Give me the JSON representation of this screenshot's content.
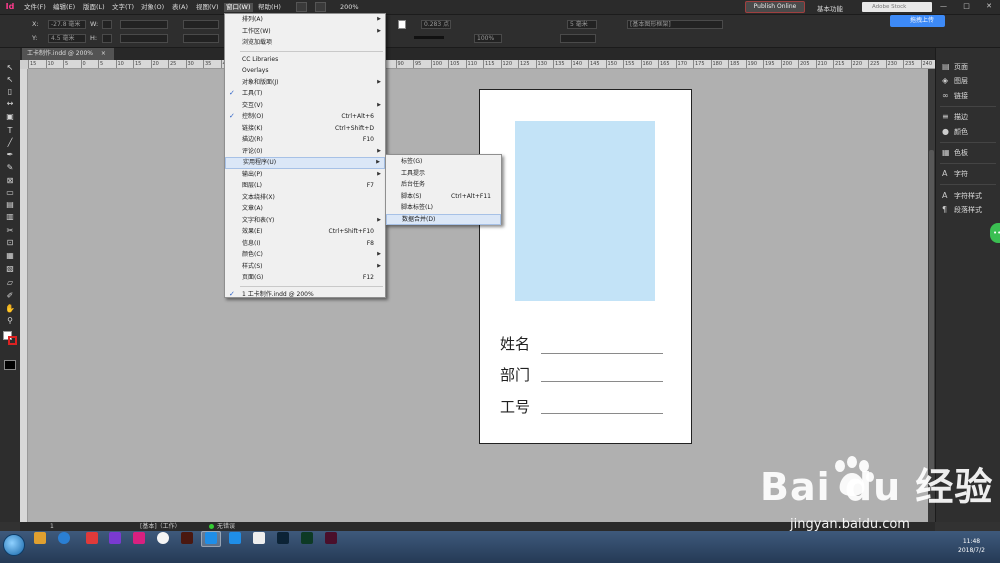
{
  "app": {
    "logo": "Id"
  },
  "menubar": {
    "items": [
      "文件(F)",
      "编辑(E)",
      "版面(L)",
      "文字(T)",
      "对象(O)",
      "表(A)",
      "视图(V)",
      "窗口(W)",
      "帮助(H)"
    ],
    "zoom": "200%",
    "publish": "Publish Online",
    "workspace": "基本功能",
    "stock_placeholder": "Adobe Stock",
    "window_controls": "— □ ✕"
  },
  "control": {
    "x_label": "X:",
    "x_value": "-27.8 毫米",
    "y_label": "Y:",
    "y_value": "4.5 毫米",
    "w_label": "W:",
    "h_label": "H:",
    "stroke_weight": "0.283 点",
    "stroke_value": "5 毫米",
    "percent": "100%",
    "frame_style": "[基本图形框架]",
    "upload": "拖拽上传"
  },
  "document": {
    "tab": "工卡制作.indd @ 200%",
    "close": "×"
  },
  "ruler": {
    "ticks": [
      "15",
      "10",
      "5",
      "0",
      "5",
      "10",
      "15",
      "20",
      "25",
      "30",
      "35",
      "40",
      "45",
      "50",
      "55",
      "60",
      "65",
      "70",
      "75",
      "80",
      "85",
      "90",
      "95",
      "100",
      "105",
      "110",
      "115",
      "120",
      "125",
      "130",
      "135",
      "140",
      "145",
      "150",
      "155",
      "160",
      "165",
      "170",
      "175",
      "180",
      "185",
      "190",
      "195",
      "200",
      "205",
      "210",
      "215",
      "220",
      "225",
      "230",
      "235",
      "240",
      "245",
      "250",
      "255",
      "260",
      "265",
      "270",
      "275",
      "280",
      "285",
      "290",
      "295",
      "300",
      "305",
      "310",
      "315",
      "320",
      "325",
      "330",
      "335",
      "340",
      "345",
      "350",
      "355",
      "360",
      "365",
      "370"
    ]
  },
  "card": {
    "fields": [
      "姓名",
      "部门",
      "工号"
    ],
    "photo_color": "#c3e3f7"
  },
  "window_menu": {
    "items": [
      {
        "label": "排列(A)",
        "arrow": true
      },
      {
        "label": "工作区(W)",
        "arrow": true
      },
      {
        "label": "浏览加载项"
      },
      {
        "sep": true
      },
      {
        "label": "CC Libraries"
      },
      {
        "label": "Overlays"
      },
      {
        "label": "对象和版面(J)",
        "arrow": true
      },
      {
        "label": "工具(T)",
        "checked": true
      },
      {
        "label": "交互(V)",
        "arrow": true
      },
      {
        "label": "控制(O)",
        "checked": true,
        "shortcut": "Ctrl+Alt+6"
      },
      {
        "label": "链接(K)",
        "shortcut": "Ctrl+Shift+D"
      },
      {
        "label": "描边(R)",
        "shortcut": "F10"
      },
      {
        "label": "评论(0)",
        "arrow": true
      },
      {
        "label": "实用程序(U)",
        "arrow": true,
        "highlighted": true
      },
      {
        "label": "输出(P)",
        "arrow": true
      },
      {
        "label": "图层(L)",
        "shortcut": "F7"
      },
      {
        "label": "文本绕排(X)"
      },
      {
        "label": "文章(A)"
      },
      {
        "label": "文字和表(Y)",
        "arrow": true
      },
      {
        "label": "效果(E)",
        "shortcut": "Ctrl+Shift+F10"
      },
      {
        "label": "信息(I)",
        "shortcut": "F8"
      },
      {
        "label": "颜色(C)",
        "arrow": true
      },
      {
        "label": "样式(S)",
        "arrow": true
      },
      {
        "label": "页面(G)",
        "shortcut": "F12"
      },
      {
        "sep": true
      },
      {
        "label": "1 工卡制作.indd @ 200%",
        "checked": true
      }
    ]
  },
  "utilities_submenu": {
    "items": [
      {
        "label": "标签(G)"
      },
      {
        "label": "工具提示"
      },
      {
        "label": "后台任务"
      },
      {
        "label": "脚本(S)",
        "shortcut": "Ctrl+Alt+F11"
      },
      {
        "label": "脚本标签(L)"
      },
      {
        "label": "数据合并(D)",
        "highlighted": true
      }
    ]
  },
  "panels": [
    {
      "icon": "▤",
      "label": "页面"
    },
    {
      "icon": "◈",
      "label": "图层"
    },
    {
      "icon": "∞",
      "label": "链接"
    },
    {
      "icon": "≡",
      "label": "描边"
    },
    {
      "icon": "●",
      "label": "颜色"
    },
    {
      "icon": "▦",
      "label": "色板"
    },
    {
      "icon": "A",
      "label": "字符"
    },
    {
      "icon": "A",
      "label": "字符样式"
    },
    {
      "icon": "¶",
      "label": "段落样式"
    }
  ],
  "status": {
    "page": "1",
    "style": "[基本]（工作）",
    "errors": "无错误"
  },
  "taskbar": {
    "time": "11:48",
    "date": "2018/7/2"
  },
  "watermark": {
    "brand": "Bai  du 经验",
    "url": "jingyan.baidu.com"
  }
}
